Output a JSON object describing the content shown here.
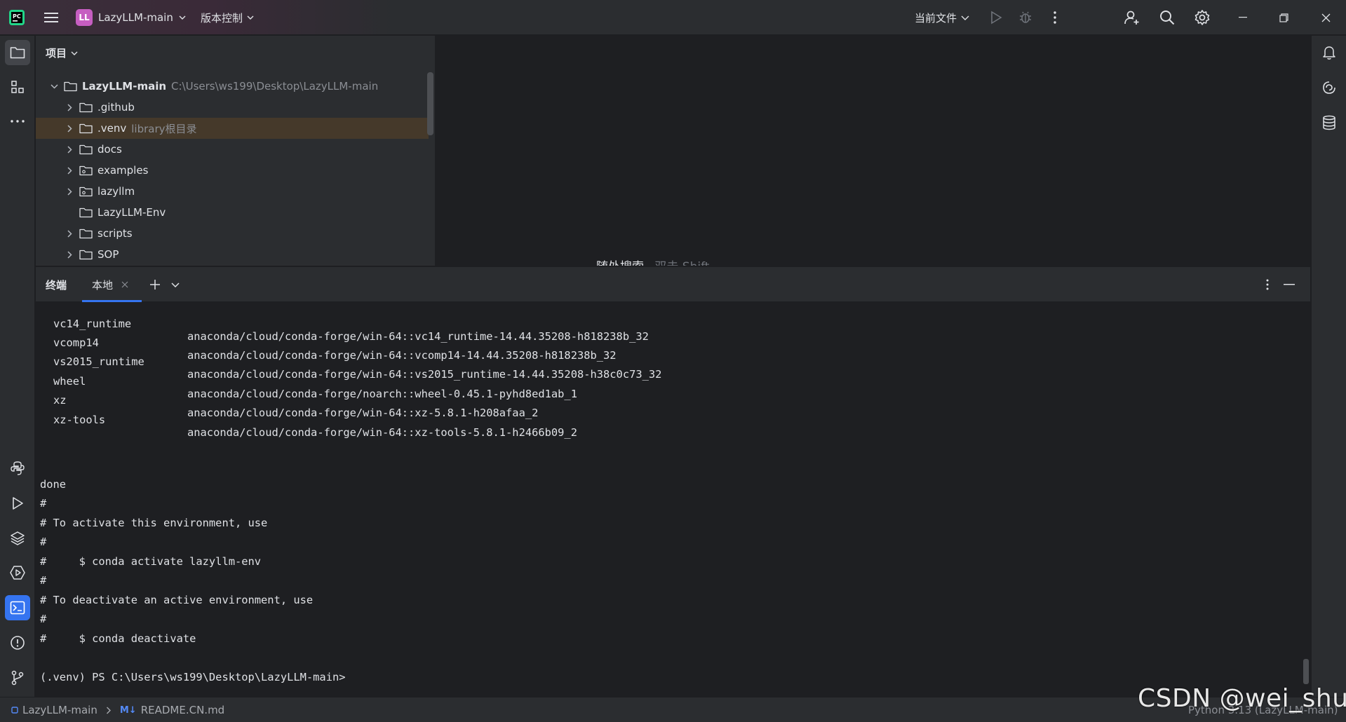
{
  "titlebar": {
    "project_badge": "LL",
    "project_name": "LazyLLM-main",
    "vcs_label": "版本控制",
    "current_file_label": "当前文件"
  },
  "project_panel": {
    "title": "项目",
    "root": {
      "name": "LazyLLM-main",
      "path": "C:\\Users\\ws199\\Desktop\\LazyLLM-main"
    },
    "items": [
      {
        "name": ".github",
        "note": ""
      },
      {
        "name": ".venv",
        "note": "library根目录"
      },
      {
        "name": "docs",
        "note": ""
      },
      {
        "name": "examples",
        "note": ""
      },
      {
        "name": "lazyllm",
        "note": ""
      },
      {
        "name": "LazyLLM-Env",
        "note": ""
      },
      {
        "name": "scripts",
        "note": ""
      },
      {
        "name": "SOP",
        "note": ""
      }
    ]
  },
  "editor": {
    "search_hint": "随处搜索",
    "search_key": "双击 Shift"
  },
  "terminal": {
    "panel_label": "终端",
    "tab_label": "本地",
    "packages": [
      {
        "name": "vc14_runtime",
        "source": "anaconda/cloud/conda-forge/win-64::vc14_runtime-14.44.35208-h818238b_32"
      },
      {
        "name": "vcomp14",
        "source": "anaconda/cloud/conda-forge/win-64::vcomp14-14.44.35208-h818238b_32"
      },
      {
        "name": "vs2015_runtime",
        "source": "anaconda/cloud/conda-forge/win-64::vs2015_runtime-14.44.35208-h38c0c73_32"
      },
      {
        "name": "wheel",
        "source": "anaconda/cloud/conda-forge/noarch::wheel-0.45.1-pyhd8ed1ab_1"
      },
      {
        "name": "xz",
        "source": "anaconda/cloud/conda-forge/win-64::xz-5.8.1-h208afaa_2"
      },
      {
        "name": "xz-tools",
        "source": "anaconda/cloud/conda-forge/win-64::xz-tools-5.8.1-h2466b09_2"
      }
    ],
    "output": [
      "done",
      "#",
      "# To activate this environment, use",
      "#",
      "#     $ conda activate lazyllm-env",
      "#",
      "# To deactivate an active environment, use",
      "#",
      "#     $ conda deactivate",
      "",
      "(.venv) PS C:\\Users\\ws199\\Desktop\\LazyLLM-main>"
    ]
  },
  "statusbar": {
    "crumb_project": "LazyLLM-main",
    "crumb_file_badge": "M↓",
    "crumb_file": "README.CN.md",
    "interpreter": "Python 3.13 (LazyLLM-main)"
  },
  "watermark": "CSDN @wei_shuo",
  "colors": {
    "accent": "#3574f0",
    "panel_bg": "#2b2d30",
    "editor_bg": "#1e1f22",
    "badge": "#c65ec1",
    "highlight_row": "#45392a"
  }
}
